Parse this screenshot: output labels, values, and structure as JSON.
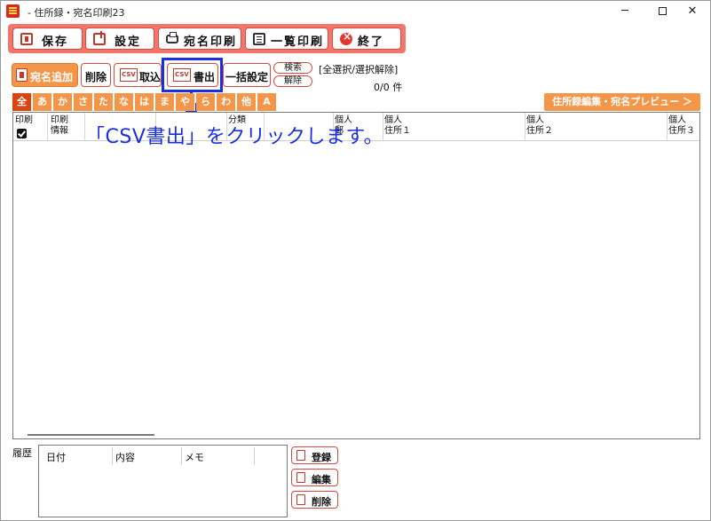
{
  "window": {
    "title": "- 住所録・宛名印刷23"
  },
  "toolbar": {
    "save": "保存",
    "settings": "設定",
    "address_print": "宛名印刷",
    "list_print": "一覧印刷",
    "exit": "終了"
  },
  "secondary": {
    "add_address": "宛名追加",
    "delete": "削除",
    "csv_import": "取込",
    "csv_export": "書出",
    "csv_tag": "CSV",
    "bulk_settings": "一括設定",
    "search": "検索",
    "clear": "解除",
    "select_all": "[全選択/選択解除]",
    "count": "0/0 件"
  },
  "kana_tabs": [
    "全",
    "あ",
    "か",
    "さ",
    "た",
    "な",
    "は",
    "ま",
    "や",
    "ら",
    "わ",
    "他",
    "A"
  ],
  "preview_button": "住所録編集・宛名プレビュー ＞",
  "callout": "「CSV書出」をクリックします。",
  "grid": {
    "columns": [
      {
        "line1": "印刷",
        "line2": ""
      },
      {
        "line1": "印刷",
        "line2": "情報"
      },
      {
        "line1": "",
        "line2": ""
      },
      {
        "line1": "",
        "line2": ""
      },
      {
        "line1": "分類",
        "line2": ""
      },
      {
        "line1": "個人",
        "line2": "郵"
      },
      {
        "line1": "個人",
        "line2": "住所１"
      },
      {
        "line1": "個人",
        "line2": "住所２"
      },
      {
        "line1": "個人",
        "line2": "住所３"
      }
    ]
  },
  "history": {
    "label": "履歴",
    "columns": [
      "日付",
      "内容",
      "メモ"
    ],
    "buttons": {
      "register": "登録",
      "edit": "編集",
      "delete": "削除"
    }
  }
}
